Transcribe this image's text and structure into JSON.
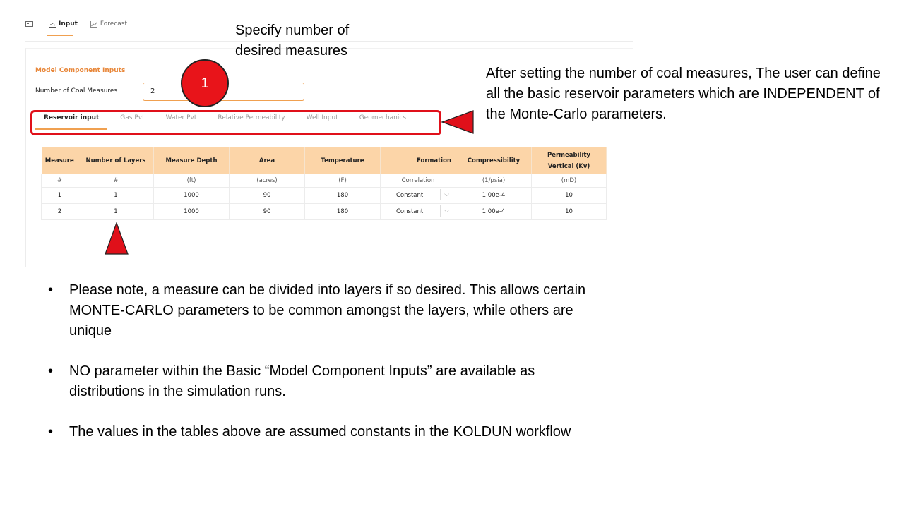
{
  "app": {
    "tabs": [
      {
        "label": "",
        "icon": "panel-icon"
      },
      {
        "label": "Input",
        "icon": "scatter-icon",
        "active": true
      },
      {
        "label": "Forecast",
        "icon": "line-chart-icon"
      }
    ],
    "section_title": "Model Component Inputs",
    "coal_measures": {
      "label": "Number of Coal Measures",
      "value": "2"
    },
    "sub_tabs": [
      "Reservoir input",
      "Gas Pvt",
      "Water Pvt",
      "Relative Permeability",
      "Well Input",
      "Geomechanics"
    ],
    "table": {
      "headers": [
        "Measure",
        "Number of Layers",
        "Measure Depth",
        "Area",
        "Temperature",
        "Formation",
        "Compressibility",
        "Permeability Vertical (Kv)"
      ],
      "units": [
        "#",
        "#",
        "(ft)",
        "(acres)",
        "(F)",
        "Correlation",
        "(1/psia)",
        "(mD)"
      ],
      "rows": [
        [
          "1",
          "1",
          "1000",
          "90",
          "180",
          "Constant",
          "1.00e-4",
          "10"
        ],
        [
          "2",
          "1",
          "1000",
          "90",
          "180",
          "Constant",
          "1.00e-4",
          "10"
        ]
      ]
    }
  },
  "annotations": {
    "specify": "Specify number of desired measures",
    "badge": "1",
    "after_setting": "After setting the number of coal measures, The user can define all the basic reservoir parameters which are INDEPENDENT of the Monte-Carlo parameters.",
    "colors": {
      "callout_red": "#e0101a",
      "accent_orange": "#f0a050",
      "header_fill": "#fcd5a8"
    }
  },
  "notes": [
    "Please note, a measure can be divided into layers if so desired.  This allows certain MONTE-CARLO parameters to be common amongst the layers, while others are unique",
    "NO parameter within the Basic “Model Component Inputs” are available as distributions in the simulation runs.",
    "The values in the tables above are assumed constants in the KOLDUN workflow"
  ]
}
